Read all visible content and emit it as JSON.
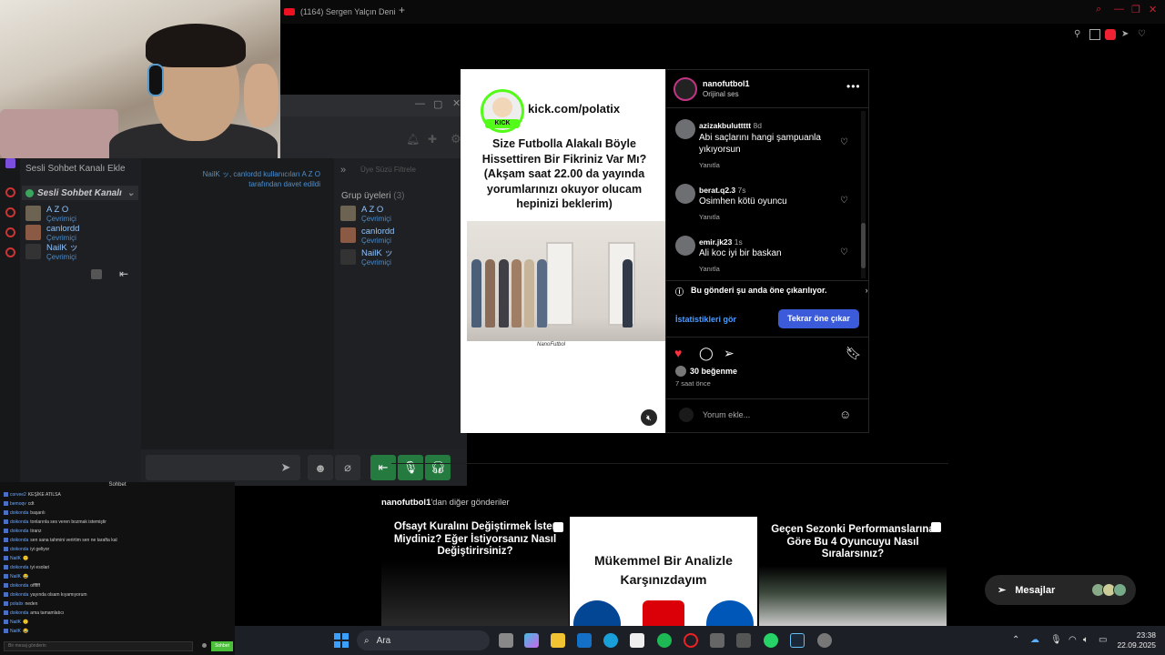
{
  "browser": {
    "tab_title": "(1164) Sergen Yalçın Deni",
    "new_tab": "+"
  },
  "voice_chat": {
    "add_channel": "Sesli Sohbet Kanalı Ekle",
    "channel_name": "Sesli Sohbet Kanalı",
    "members": [
      {
        "name": "A Z O",
        "status": "Çevrimiçi"
      },
      {
        "name": "canlordd",
        "status": "Çevrimiçi"
      },
      {
        "name": "NailK ッ",
        "status": "Çevrimiçi"
      }
    ],
    "invite_text": "NailK ッ, canlordd kullanıcıları A Z O tarafından davet edildi",
    "filter_placeholder": "Üye Süzü Filtrele",
    "group_title": "Grup üyeleri",
    "group_count": "(3)"
  },
  "chat": {
    "header": "Sohbet",
    "lines": [
      {
        "user": "corvee2",
        "text": "KEŞİKE ATILSA"
      },
      {
        "user": "bemoqv",
        "text": "cdt"
      },
      {
        "user": "doikonda",
        "text": "başarılı"
      },
      {
        "user": "doikonda",
        "text": "tonlarınla ses veren bozmak istemiştir"
      },
      {
        "user": "doikonda",
        "text": "tiranz"
      },
      {
        "user": "doikonda",
        "text": "sen sana tahmini verirtim sen ne tarafta kal"
      },
      {
        "user": "doikonda",
        "text": "iyi geliyor"
      },
      {
        "user": "NailK",
        "text": "🙂"
      },
      {
        "user": "doikonda",
        "text": "iyi esolari"
      },
      {
        "user": "NailK",
        "text": "😂"
      },
      {
        "user": "doikonda",
        "text": "offffff"
      },
      {
        "user": "doikonda",
        "text": "yayında olsam kıyamıyorum"
      },
      {
        "user": "polatix",
        "text": "neden"
      },
      {
        "user": "doikonda",
        "text": "ama tamamlatıcı"
      },
      {
        "user": "NailK",
        "text": "🙂"
      },
      {
        "user": "NailK",
        "text": "😂"
      }
    ],
    "input_placeholder": "Bir mesaj gönderin",
    "send": "Sohbet"
  },
  "post": {
    "kick_url": "kick.com/polatix",
    "question": "Size Futbolla Alakalı Böyle Hissettiren Bir Fikriniz Var Mı?(Akşam saat 22.00 da yayında yorumlarınızı okuyor olucam hepinizi beklerim)",
    "watermark": "NanoFutbol",
    "mute_icon": "muted-speaker-icon"
  },
  "instagram": {
    "username": "nanofutbol1",
    "audio": "Orijinal ses",
    "comments": [
      {
        "user": "azizakbuluttttt",
        "time": "8d",
        "text": "Abi saçlarını hangi şampuanla yıkıyorsun",
        "reply": "Yanıtla"
      },
      {
        "user": "berat.q2.3",
        "time": "7s",
        "text": "Osimhen kötü oyuncu",
        "reply": "Yanıtla"
      },
      {
        "user": "emir.jk23",
        "time": "1s",
        "text": "Ali koc iyi bir baskan",
        "reply": "Yanıtla"
      }
    ],
    "boost_notice": "Bu gönderi şu anda öne çıkarılıyor.",
    "stats_link": "İstatistikleri gör",
    "boost_again": "Tekrar öne çıkar",
    "likes": "30 beğenme",
    "time_ago": "7 saat önce",
    "comment_placeholder": "Yorum ekle...",
    "liked": true
  },
  "more_posts": {
    "title_user": "nanofutbol1",
    "title_rest": "'dan diğer gönderiler",
    "items": [
      {
        "text": "Ofsayt Kuralını Değiştirmek İster Miydiniz? Eğer İstiyorsanız Nasıl Değiştirirsiniz?"
      },
      {
        "text": "Mükemmel Bir Analizle Karşınızdayım"
      },
      {
        "text": "Geçen Sezonki Performanslarına Göre Bu 4 Oyuncuyu Nasıl Sıralarsınız?"
      }
    ]
  },
  "messages": {
    "label": "Mesajlar"
  },
  "taskbar": {
    "search": "Ara",
    "time": "23:38",
    "date": "22.09.2025"
  },
  "colors": {
    "instagram_blue": "#3b5bdb",
    "like_red": "#ff3040",
    "kick_green": "#53fc18",
    "discord_green": "#3ba55d"
  }
}
